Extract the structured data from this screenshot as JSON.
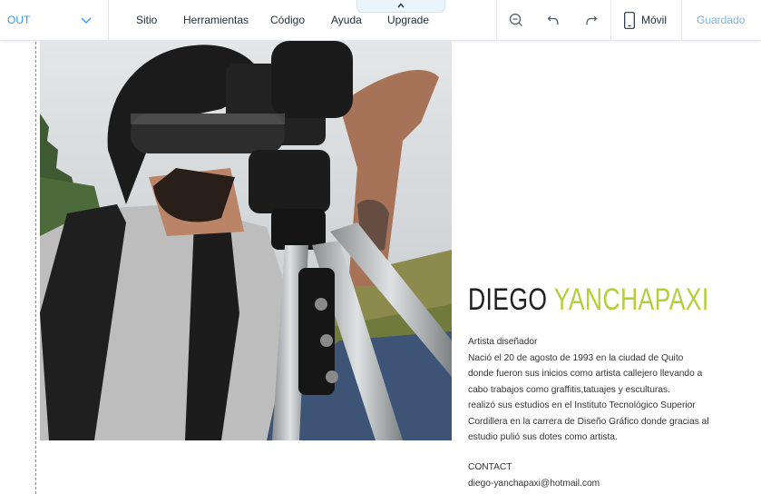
{
  "topbar": {
    "page_selector": "OUT",
    "menu": [
      "Sitio",
      "Herramientas",
      "Código",
      "Ayuda",
      "Upgrade"
    ],
    "mobile_label": "Móvil",
    "saved_label": "Guardado",
    "accent_color": "#3899ec",
    "icons": [
      "chevron-down-icon",
      "chevron-up-icon",
      "zoom-out-icon",
      "undo-icon",
      "redo-icon",
      "mobile-icon"
    ]
  },
  "profile": {
    "first_name": "DIEGO",
    "last_name": "YANCHAPAXI",
    "name_accent_color": "#b3cf3a",
    "bio_lines": [
      "Artista diseñador",
      "Nació el 20 de agosto de 1993 en la ciudad de Quito",
      "donde fueron sus inicios como artista callejero llevando a",
      "cabo trabajos como graffitis,tatuajes y esculturas.",
      "realizó sus estudios en el Instituto Tecnológico Superior",
      "Cordillera en la carrera de Diseño Gráfico donde gracias al",
      "estudio pulió sus dotes como artista."
    ],
    "contact_heading": "CONTACT",
    "contact_email": "diego-yanchapaxi@hotmail.com"
  }
}
